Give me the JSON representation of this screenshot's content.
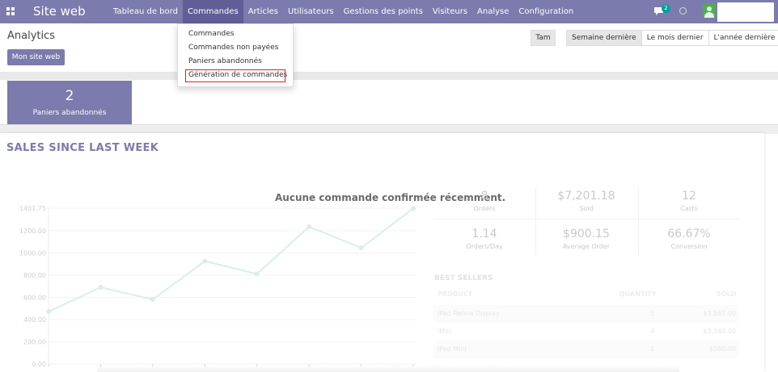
{
  "topbar": {
    "brand": "Site web",
    "nav": [
      "Tableau de bord",
      "Commandes",
      "Articles",
      "Utilisateurs",
      "Gestions des points",
      "Visiteurs",
      "Analyse",
      "Configuration"
    ],
    "active_index": 1,
    "chat_badge": "2",
    "colors": {
      "bar": "#7c7bad",
      "active": "#5f5e97",
      "badge": "#00a09d",
      "avatar": "#4caf50"
    }
  },
  "control": {
    "breadcrumb": "Analytics",
    "site_button": "Mon site web",
    "tam_button": "Tam",
    "periods": [
      "Semaine dernière",
      "Le mois dernier",
      "L'année dernière"
    ],
    "active_period": 0
  },
  "dropdown": {
    "items": [
      "Commandes",
      "Commandes non payées",
      "Paniers abandonnés",
      "Génération de commandes"
    ],
    "highlighted": 3
  },
  "kpi": {
    "value": "2",
    "label": "Paniers abandonnés"
  },
  "sales": {
    "title": "SALES SINCE LAST WEEK",
    "empty_message": "Aucune commande confirmée récemment.",
    "stats": [
      {
        "value": "8",
        "label": "Orders"
      },
      {
        "value": "$7,201.18",
        "label": "Sold"
      },
      {
        "value": "12",
        "label": "Carts"
      },
      {
        "value": "1.14",
        "label": "Orders/Day"
      },
      {
        "value": "$900.15",
        "label": "Average Order"
      },
      {
        "value": "66.67%",
        "label": "Conversion"
      }
    ],
    "best_sellers": {
      "title": "BEST SELLERS",
      "headers": [
        "PRODUCT",
        "QUANTITY",
        "SOLD"
      ],
      "rows": [
        [
          "iPad Retina Display",
          "5",
          "$3,567.00"
        ],
        [
          "iMac",
          "4",
          "$3,540.00"
        ],
        [
          "iPad Mini",
          "1",
          "$590.00"
        ]
      ]
    }
  },
  "chart_data": {
    "type": "line",
    "title": "",
    "y_tick_labels": [
      "1401.75",
      "1200.00",
      "1000.00",
      "800.00",
      "600.00",
      "400.00",
      "200.00",
      "0.00"
    ],
    "ylim": [
      0,
      1401.75
    ],
    "values": [
      470,
      690,
      580,
      925,
      810,
      1235,
      1045,
      1400
    ],
    "grid": true,
    "color": "#d9efe9"
  }
}
